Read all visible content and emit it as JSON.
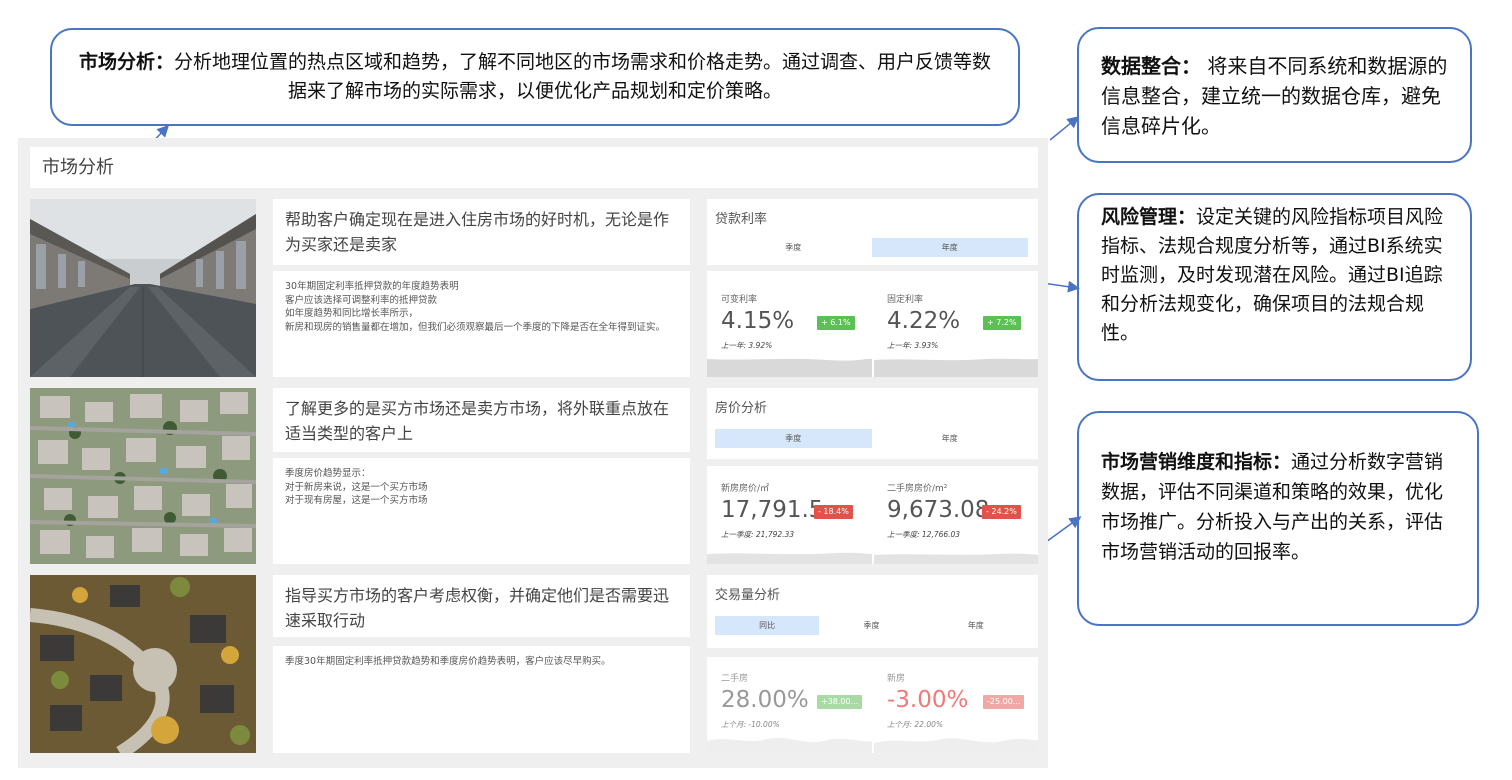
{
  "callouts": {
    "top": {
      "head": "市场分析：",
      "body": "分析地理位置的热点区域和趋势，了解不同地区的市场需求和价格走势。通过调查、用户反馈等数据来了解市场的实际需求，以便优化产品规划和定价策略。"
    },
    "right1": {
      "head": "数据整合：",
      "body": " 将来自不同系统和数据源的信息整合，建立统一的数据仓库，避免信息碎片化。"
    },
    "right2": {
      "head": "风险管理：",
      "body": "设定关键的风险指标项目风险指标、法规合规度分析等，通过BI系统实时监测，及时发现潜在风险。通过BI追踪和分析法规变化，确保项目的法规合规性。"
    },
    "right3": {
      "head": "市场营销维度和指标：",
      "body": "通过分析数字营销数据，评估不同渠道和策略的效果，优化市场推广。分析投入与产出的关系，评估市场营销活动的回报率。"
    }
  },
  "dashboard": {
    "title": "市场分析",
    "rows": [
      {
        "headline": "帮助客户确定现在是进入住房市场的好时机，无论是作为买家还是卖家",
        "desc": [
          "30年期固定利率抵押贷款的年度趋势表明",
          "客户应该选择可调整利率的抵押贷款",
          "如年度趋势和同比增长率所示，",
          "新房和现房的销售量都在增加，但我们必须观察最后一个季度的下降是否在全年得到证实。"
        ],
        "card_title": "贷款利率",
        "tabs": [
          "季度",
          "年度"
        ],
        "active_tab": 1,
        "metrics": [
          {
            "label": "可变利率",
            "value": "4.15%",
            "badge": "+ 6.1%",
            "badge_color": "green",
            "prev": "上一年: 3.92%"
          },
          {
            "label": "固定利率",
            "value": "4.22%",
            "badge": "+ 7.2%",
            "badge_color": "green",
            "prev": "上一年: 3.93%"
          }
        ]
      },
      {
        "headline": "了解更多的是买方市场还是卖方市场，将外联重点放在适当类型的客户上",
        "desc": [
          "季度房价趋势显示：",
          "对于新房来说，这是一个买方市场",
          "对于现有房屋，这是一个买方市场"
        ],
        "card_title": "房价分析",
        "tabs": [
          "季度",
          "年度"
        ],
        "active_tab": 0,
        "metrics": [
          {
            "label": "新房房价/㎡",
            "value": "17,791.5",
            "badge": "- 18.4%",
            "badge_color": "red",
            "prev": "上一季度: 21,792.33"
          },
          {
            "label": "二手房房价/m²",
            "value": "9,673.08",
            "badge": "- 24.2%",
            "badge_color": "red",
            "prev": "上一季度: 12,766.03"
          }
        ]
      },
      {
        "headline": "指导买方市场的客户考虑权衡，并确定他们是否需要迅速采取行动",
        "desc": [
          "季度30年期固定利率抵押贷款趋势和季度房价趋势表明，客户应该尽早购买。"
        ],
        "card_title": "交易量分析",
        "tabs": [
          "同比",
          "季度",
          "年度"
        ],
        "active_tab": 0,
        "metrics": [
          {
            "label": "二手房",
            "value": "28.00%",
            "badge": "+38.00...",
            "badge_color": "faded-green",
            "prev": "上个月: -10.00%"
          },
          {
            "label": "新房",
            "value": "-3.00%",
            "badge": "-25.00...",
            "badge_color": "faded-red",
            "prev": "上个月: 22.00%"
          }
        ]
      }
    ]
  },
  "colors": {
    "accent": "#4a74c4",
    "tab_active": "#d6e7fb",
    "green": "#5cc155",
    "red": "#e0534b"
  }
}
